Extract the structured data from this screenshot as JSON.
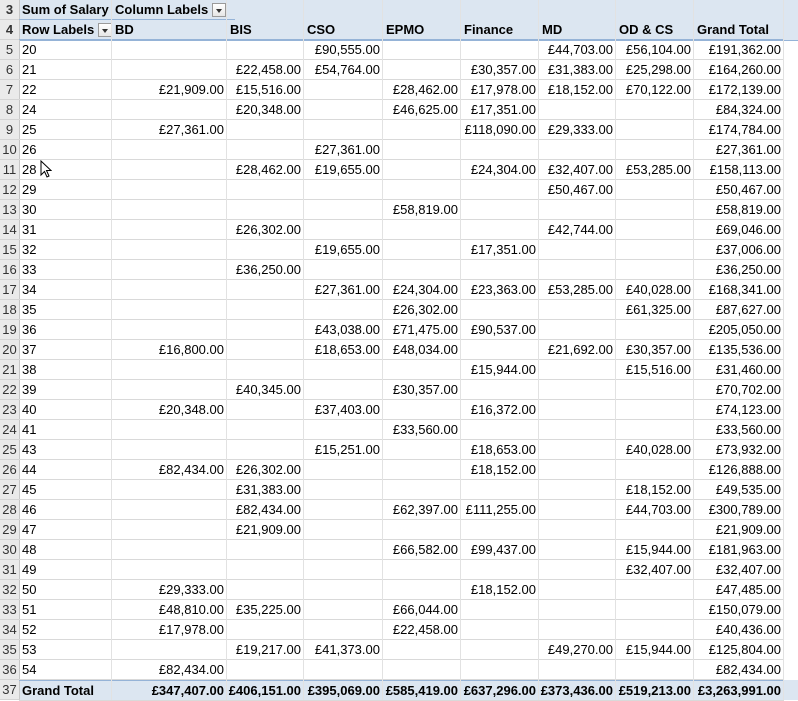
{
  "pivot": {
    "value_field": "Sum of Salary",
    "column_labels": "Column Labels",
    "row_labels": "Row Labels",
    "columns": [
      "BD",
      "BIS",
      "CSO",
      "EPMO",
      "Finance",
      "MD",
      "OD & CS",
      "Grand Total"
    ],
    "header_row_numbers": [
      "3",
      "4"
    ],
    "rows": [
      {
        "n": "5",
        "label": "20",
        "v": [
          "",
          "",
          "£90,555.00",
          "",
          "",
          "£44,703.00",
          "£56,104.00",
          "£191,362.00"
        ]
      },
      {
        "n": "6",
        "label": "21",
        "v": [
          "",
          "£22,458.00",
          "£54,764.00",
          "",
          "£30,357.00",
          "£31,383.00",
          "£25,298.00",
          "£164,260.00"
        ]
      },
      {
        "n": "7",
        "label": "22",
        "v": [
          "£21,909.00",
          "£15,516.00",
          "",
          "£28,462.00",
          "£17,978.00",
          "£18,152.00",
          "£70,122.00",
          "£172,139.00"
        ]
      },
      {
        "n": "8",
        "label": "24",
        "v": [
          "",
          "£20,348.00",
          "",
          "£46,625.00",
          "£17,351.00",
          "",
          "",
          "£84,324.00"
        ]
      },
      {
        "n": "9",
        "label": "25",
        "v": [
          "£27,361.00",
          "",
          "",
          "",
          "£118,090.00",
          "£29,333.00",
          "",
          "£174,784.00"
        ]
      },
      {
        "n": "10",
        "label": "26",
        "v": [
          "",
          "",
          "£27,361.00",
          "",
          "",
          "",
          "",
          "£27,361.00"
        ]
      },
      {
        "n": "11",
        "label": "28",
        "v": [
          "",
          "£28,462.00",
          "£19,655.00",
          "",
          "£24,304.00",
          "£32,407.00",
          "£53,285.00",
          "£158,113.00"
        ]
      },
      {
        "n": "12",
        "label": "29",
        "v": [
          "",
          "",
          "",
          "",
          "",
          "£50,467.00",
          "",
          "£50,467.00"
        ]
      },
      {
        "n": "13",
        "label": "30",
        "v": [
          "",
          "",
          "",
          "£58,819.00",
          "",
          "",
          "",
          "£58,819.00"
        ]
      },
      {
        "n": "14",
        "label": "31",
        "v": [
          "",
          "£26,302.00",
          "",
          "",
          "",
          "£42,744.00",
          "",
          "£69,046.00"
        ]
      },
      {
        "n": "15",
        "label": "32",
        "v": [
          "",
          "",
          "£19,655.00",
          "",
          "£17,351.00",
          "",
          "",
          "£37,006.00"
        ]
      },
      {
        "n": "16",
        "label": "33",
        "v": [
          "",
          "£36,250.00",
          "",
          "",
          "",
          "",
          "",
          "£36,250.00"
        ]
      },
      {
        "n": "17",
        "label": "34",
        "v": [
          "",
          "",
          "£27,361.00",
          "£24,304.00",
          "£23,363.00",
          "£53,285.00",
          "£40,028.00",
          "£168,341.00"
        ]
      },
      {
        "n": "18",
        "label": "35",
        "v": [
          "",
          "",
          "",
          "£26,302.00",
          "",
          "",
          "£61,325.00",
          "£87,627.00"
        ]
      },
      {
        "n": "19",
        "label": "36",
        "v": [
          "",
          "",
          "£43,038.00",
          "£71,475.00",
          "£90,537.00",
          "",
          "",
          "£205,050.00"
        ]
      },
      {
        "n": "20",
        "label": "37",
        "v": [
          "£16,800.00",
          "",
          "£18,653.00",
          "£48,034.00",
          "",
          "£21,692.00",
          "£30,357.00",
          "£135,536.00"
        ]
      },
      {
        "n": "21",
        "label": "38",
        "v": [
          "",
          "",
          "",
          "",
          "£15,944.00",
          "",
          "£15,516.00",
          "£31,460.00"
        ]
      },
      {
        "n": "22",
        "label": "39",
        "v": [
          "",
          "£40,345.00",
          "",
          "£30,357.00",
          "",
          "",
          "",
          "£70,702.00"
        ]
      },
      {
        "n": "23",
        "label": "40",
        "v": [
          "£20,348.00",
          "",
          "£37,403.00",
          "",
          "£16,372.00",
          "",
          "",
          "£74,123.00"
        ]
      },
      {
        "n": "24",
        "label": "41",
        "v": [
          "",
          "",
          "",
          "£33,560.00",
          "",
          "",
          "",
          "£33,560.00"
        ]
      },
      {
        "n": "25",
        "label": "43",
        "v": [
          "",
          "",
          "£15,251.00",
          "",
          "£18,653.00",
          "",
          "£40,028.00",
          "£73,932.00"
        ]
      },
      {
        "n": "26",
        "label": "44",
        "v": [
          "£82,434.00",
          "£26,302.00",
          "",
          "",
          "£18,152.00",
          "",
          "",
          "£126,888.00"
        ]
      },
      {
        "n": "27",
        "label": "45",
        "v": [
          "",
          "£31,383.00",
          "",
          "",
          "",
          "",
          "£18,152.00",
          "£49,535.00"
        ]
      },
      {
        "n": "28",
        "label": "46",
        "v": [
          "",
          "£82,434.00",
          "",
          "£62,397.00",
          "£111,255.00",
          "",
          "£44,703.00",
          "£300,789.00"
        ]
      },
      {
        "n": "29",
        "label": "47",
        "v": [
          "",
          "£21,909.00",
          "",
          "",
          "",
          "",
          "",
          "£21,909.00"
        ]
      },
      {
        "n": "30",
        "label": "48",
        "v": [
          "",
          "",
          "",
          "£66,582.00",
          "£99,437.00",
          "",
          "£15,944.00",
          "£181,963.00"
        ]
      },
      {
        "n": "31",
        "label": "49",
        "v": [
          "",
          "",
          "",
          "",
          "",
          "",
          "£32,407.00",
          "£32,407.00"
        ]
      },
      {
        "n": "32",
        "label": "50",
        "v": [
          "£29,333.00",
          "",
          "",
          "",
          "£18,152.00",
          "",
          "",
          "£47,485.00"
        ]
      },
      {
        "n": "33",
        "label": "51",
        "v": [
          "£48,810.00",
          "£35,225.00",
          "",
          "£66,044.00",
          "",
          "",
          "",
          "£150,079.00"
        ]
      },
      {
        "n": "34",
        "label": "52",
        "v": [
          "£17,978.00",
          "",
          "",
          "£22,458.00",
          "",
          "",
          "",
          "£40,436.00"
        ]
      },
      {
        "n": "35",
        "label": "53",
        "v": [
          "",
          "£19,217.00",
          "£41,373.00",
          "",
          "",
          "£49,270.00",
          "£15,944.00",
          "£125,804.00"
        ]
      },
      {
        "n": "36",
        "label": "54",
        "v": [
          "£82,434.00",
          "",
          "",
          "",
          "",
          "",
          "",
          "£82,434.00"
        ]
      }
    ],
    "total": {
      "n": "37",
      "label": "Grand Total",
      "v": [
        "£347,407.00",
        "£406,151.00",
        "£395,069.00",
        "£585,419.00",
        "£637,296.00",
        "£373,436.00",
        "£519,213.00",
        "£3,263,991.00"
      ]
    }
  }
}
